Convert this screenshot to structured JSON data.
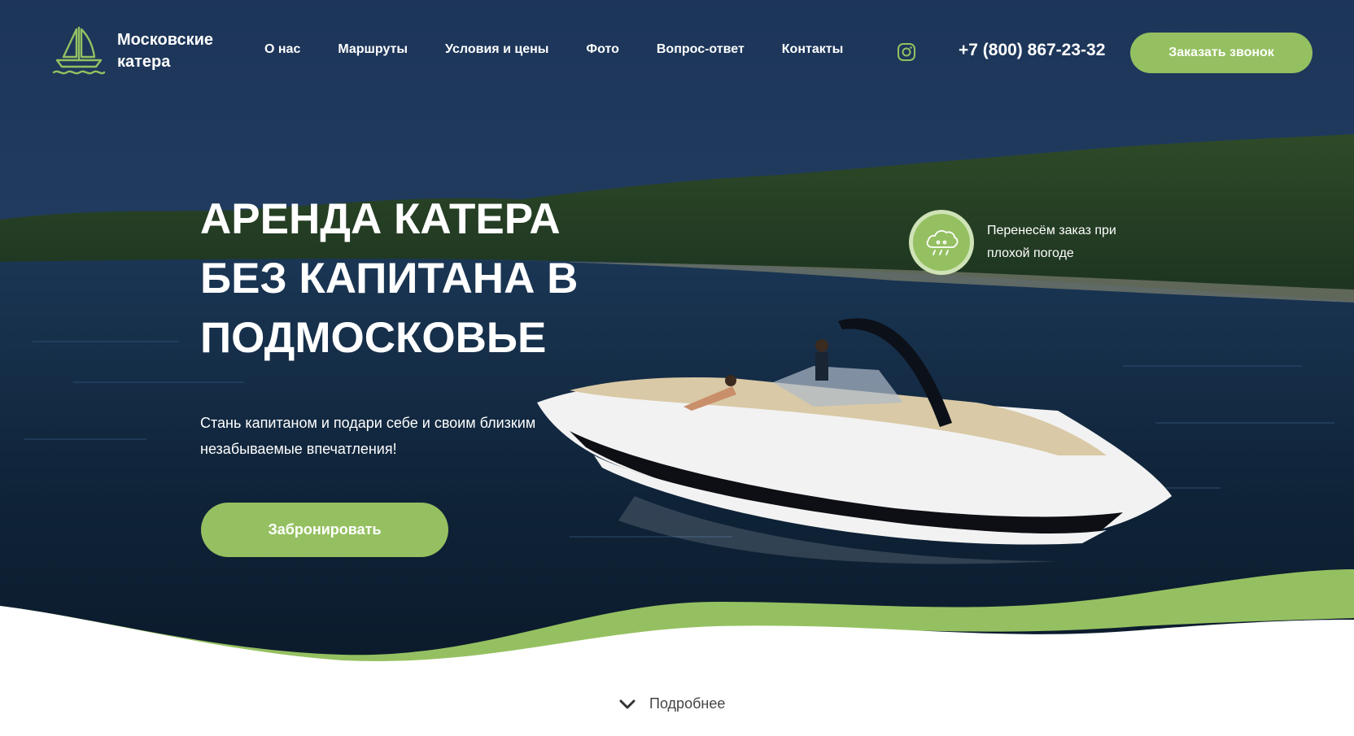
{
  "brand": {
    "name": "Московские катера",
    "accent_color": "#95c061"
  },
  "nav": {
    "items": [
      "О нас",
      "Маршруты",
      "Условия и цены",
      "Фото",
      "Вопрос-ответ",
      "Контакты"
    ]
  },
  "header": {
    "instagram_icon": "instagram-icon",
    "phone": "+7 (800) 867-23-32",
    "call_button": "Заказать звонок"
  },
  "hero": {
    "title": "Аренда катера без капитана в Подмосковье",
    "subtitle": "Стань капитаном и подари себе и своим близким незабываемые впечатления!",
    "book_button": "Забронировать",
    "weather_icon": "cloud-rain-icon",
    "weather_note": "Перенесём заказ при плохой погоде"
  },
  "footer_hint": {
    "icon": "chevron-down-icon",
    "label": "Подробнее"
  }
}
